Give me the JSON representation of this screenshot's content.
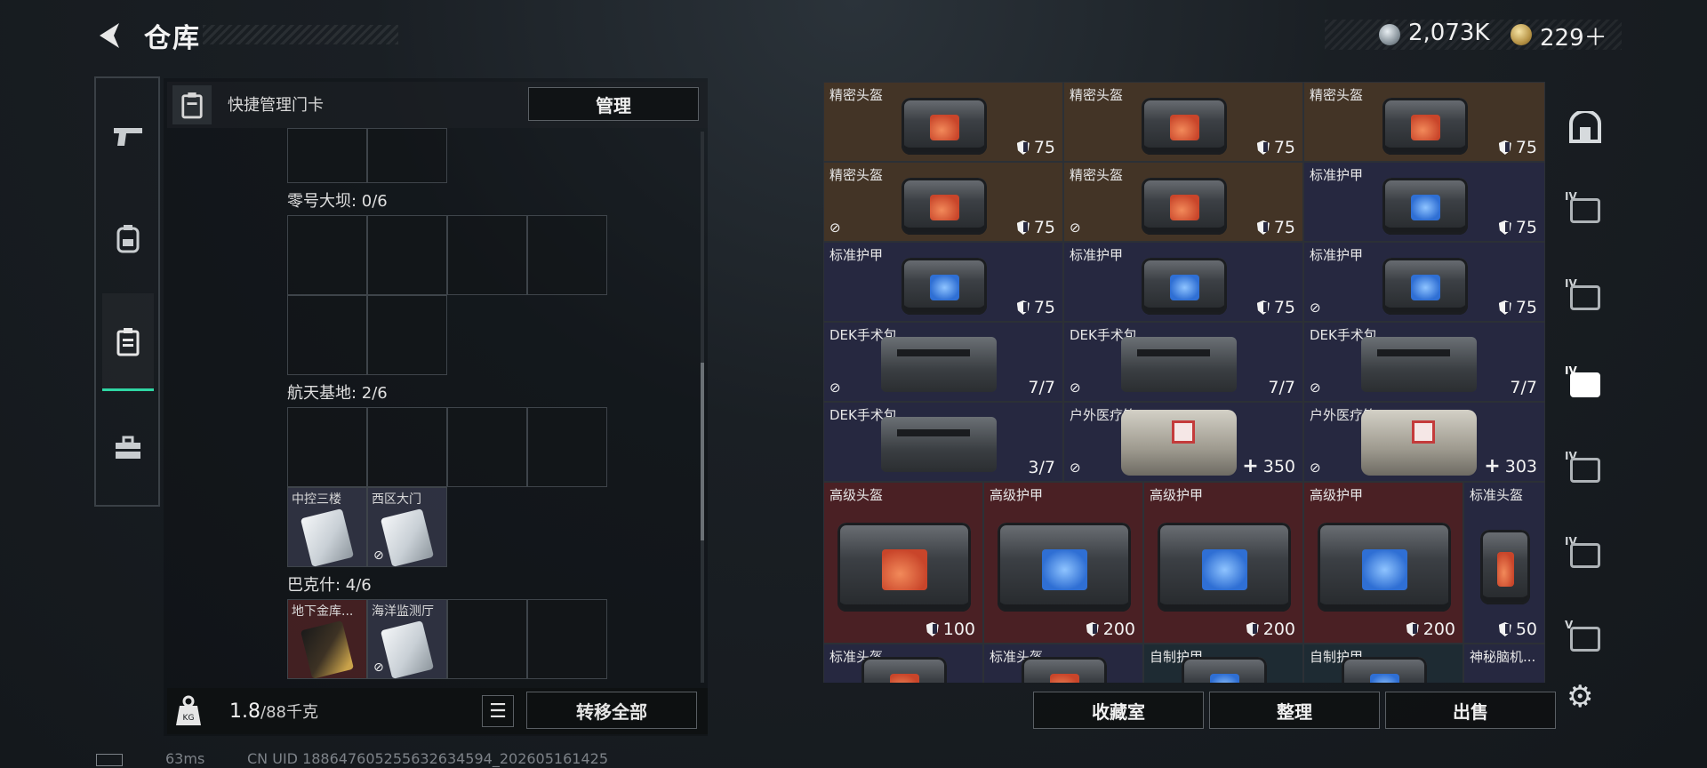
{
  "header": {
    "title": "仓库",
    "currency_silver": "2,073K",
    "currency_gold": "229＋"
  },
  "left_tabs": [
    {
      "icon": "pistol-icon"
    },
    {
      "icon": "backpack-icon"
    },
    {
      "icon": "keycard-case-icon",
      "active": true
    },
    {
      "icon": "toolbox-icon"
    }
  ],
  "card_panel": {
    "quick_label": "快捷管理门卡",
    "manage_label": "管理",
    "areas": [
      {
        "name": "零号大坝: 0/6"
      },
      {
        "name": "航天基地: 2/6",
        "cards": [
          "中控三楼",
          "西区大门"
        ]
      },
      {
        "name": "巴克什: 4/6",
        "cards": [
          "地下金库...",
          "海洋监测厅"
        ]
      }
    ],
    "weight_value": "1.8",
    "weight_max": "/88千克",
    "transfer_label": "转移全部"
  },
  "status": {
    "latency": "63ms",
    "uid": "CN UID 1886476052556326​34594_202605161425"
  },
  "inventory": {
    "rows": [
      [
        {
          "name": "精密头盔",
          "value": "75",
          "kind": "shield"
        },
        {
          "name": "精密头盔",
          "value": "75",
          "kind": "shield"
        },
        {
          "name": "精密头盔",
          "value": "75",
          "kind": "shield"
        }
      ],
      [
        {
          "name": "精密头盔",
          "value": "75",
          "kind": "shield"
        },
        {
          "name": "精密头盔",
          "value": "75",
          "kind": "shield"
        },
        {
          "name": "标准护甲",
          "value": "75",
          "kind": "shield"
        }
      ],
      [
        {
          "name": "标准护甲",
          "value": "75",
          "kind": "shield"
        },
        {
          "name": "标准护甲",
          "value": "75",
          "kind": "shield"
        },
        {
          "name": "标准护甲",
          "value": "75",
          "kind": "shield"
        }
      ],
      [
        {
          "name": "DEK手术包",
          "value": "7/7"
        },
        {
          "name": "DEK手术包",
          "value": "7/7"
        },
        {
          "name": "DEK手术包",
          "value": "7/7"
        }
      ],
      [
        {
          "name": "DEK手术包",
          "value": "3/7"
        },
        {
          "name": "户外医疗箱",
          "value": "350",
          "kind": "plus"
        },
        {
          "name": "户外医疗箱",
          "value": "303",
          "kind": "plus"
        }
      ],
      [
        {
          "name": "高级头盔",
          "value": "100",
          "kind": "shield"
        },
        {
          "name": "高级护甲",
          "value": "200",
          "kind": "shield"
        },
        {
          "name": "高级护甲",
          "value": "200",
          "kind": "shield"
        },
        {
          "name": "高级护甲",
          "value": "200",
          "kind": "shield"
        },
        {
          "name": "标准头盔",
          "value": "50",
          "kind": "shield"
        }
      ],
      [
        {
          "name": "标准头盔"
        },
        {
          "name": "标准头盔"
        },
        {
          "name": "自制护甲"
        },
        {
          "name": "自制护甲"
        },
        {
          "name": "神秘脑机..."
        }
      ]
    ]
  },
  "actions": {
    "collection": "收藏室",
    "organize": "整理",
    "sell": "出售"
  },
  "right_tabs": [
    {
      "icon": "safe-icon"
    },
    {
      "icon": "crate-icon",
      "level": "IV"
    },
    {
      "icon": "folder-icon",
      "level": "IV"
    },
    {
      "icon": "medical-case-icon",
      "level": "IV"
    },
    {
      "icon": "gun-case-icon",
      "level": "IV"
    },
    {
      "icon": "crate-icon",
      "level": "IV"
    },
    {
      "icon": "ammo-case-icon",
      "level": "V"
    }
  ]
}
